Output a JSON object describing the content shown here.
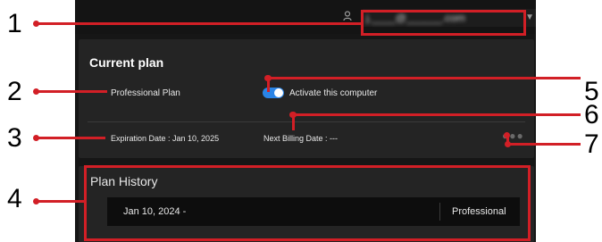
{
  "account": {
    "email": "j.____@______.com",
    "user_icon": "user-icon",
    "caret_icon": "caret-down-icon"
  },
  "current_plan": {
    "title": "Current plan",
    "plan_name": "Professional Plan",
    "activate_label": "Activate this computer",
    "activate_on": true,
    "expiration": "Expiration Date : Jan 10, 2025",
    "next_billing": "Next Billing Date : ---",
    "more_icon": "more-dots-icon"
  },
  "plan_history": {
    "title": "Plan History",
    "rows": [
      {
        "date": "Jan 10, 2024 -",
        "plan": "Professional"
      }
    ]
  },
  "callouts": [
    "1",
    "2",
    "3",
    "4",
    "5",
    "6",
    "7"
  ],
  "colors": {
    "callout": "#d21f26",
    "panel": "#161616",
    "card": "#242424",
    "toggle": "#2a84e6"
  }
}
